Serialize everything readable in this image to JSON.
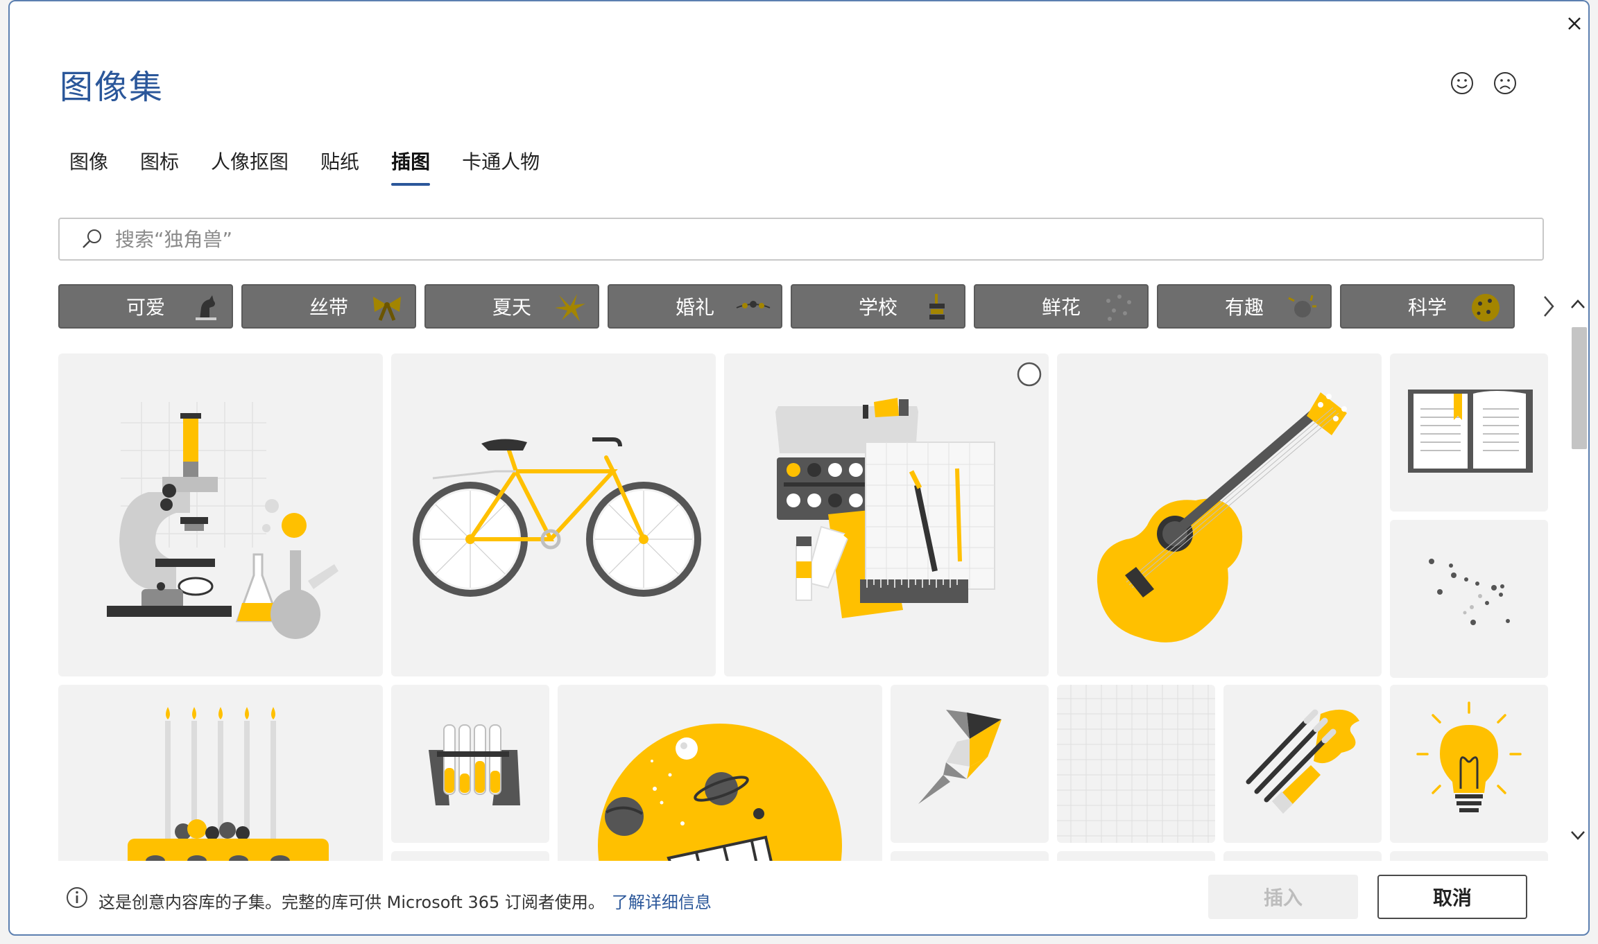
{
  "dialog": {
    "title": "图像集"
  },
  "tabs": [
    {
      "label": "图像"
    },
    {
      "label": "图标"
    },
    {
      "label": "人像抠图"
    },
    {
      "label": "贴纸"
    },
    {
      "label": "插图",
      "active": true
    },
    {
      "label": "卡通人物"
    }
  ],
  "search": {
    "placeholder": "搜索“独角兽”"
  },
  "categories": [
    {
      "label": "可爱"
    },
    {
      "label": "丝带"
    },
    {
      "label": "夏天"
    },
    {
      "label": "婚礼"
    },
    {
      "label": "学校"
    },
    {
      "label": "鲜花"
    },
    {
      "label": "有趣"
    },
    {
      "label": "科学"
    }
  ],
  "illustrations": [
    {
      "icon": "microscope-illustration"
    },
    {
      "icon": "bicycle-illustration"
    },
    {
      "icon": "paint-supplies-illustration"
    },
    {
      "icon": "guitar-illustration"
    },
    {
      "icon": "open-book-illustration"
    },
    {
      "icon": "dots-illustration"
    },
    {
      "icon": "birthday-cake-illustration"
    },
    {
      "icon": "test-tubes-illustration"
    },
    {
      "icon": "planet-space-illustration"
    },
    {
      "icon": "origami-bird-illustration"
    },
    {
      "icon": "grid-paper-illustration"
    },
    {
      "icon": "paint-brushes-illustration"
    },
    {
      "icon": "light-bulb-illustration"
    }
  ],
  "footer": {
    "info": "这是创意内容库的子集。完整的库可供 Microsoft 365 订阅者使用。",
    "link": "了解详细信息",
    "insert_label": "插入",
    "cancel_label": "取消"
  },
  "colors": {
    "accent": "#2b579a",
    "illustration_yellow": "#ffc000",
    "chip_gray": "#6e6e6e"
  }
}
